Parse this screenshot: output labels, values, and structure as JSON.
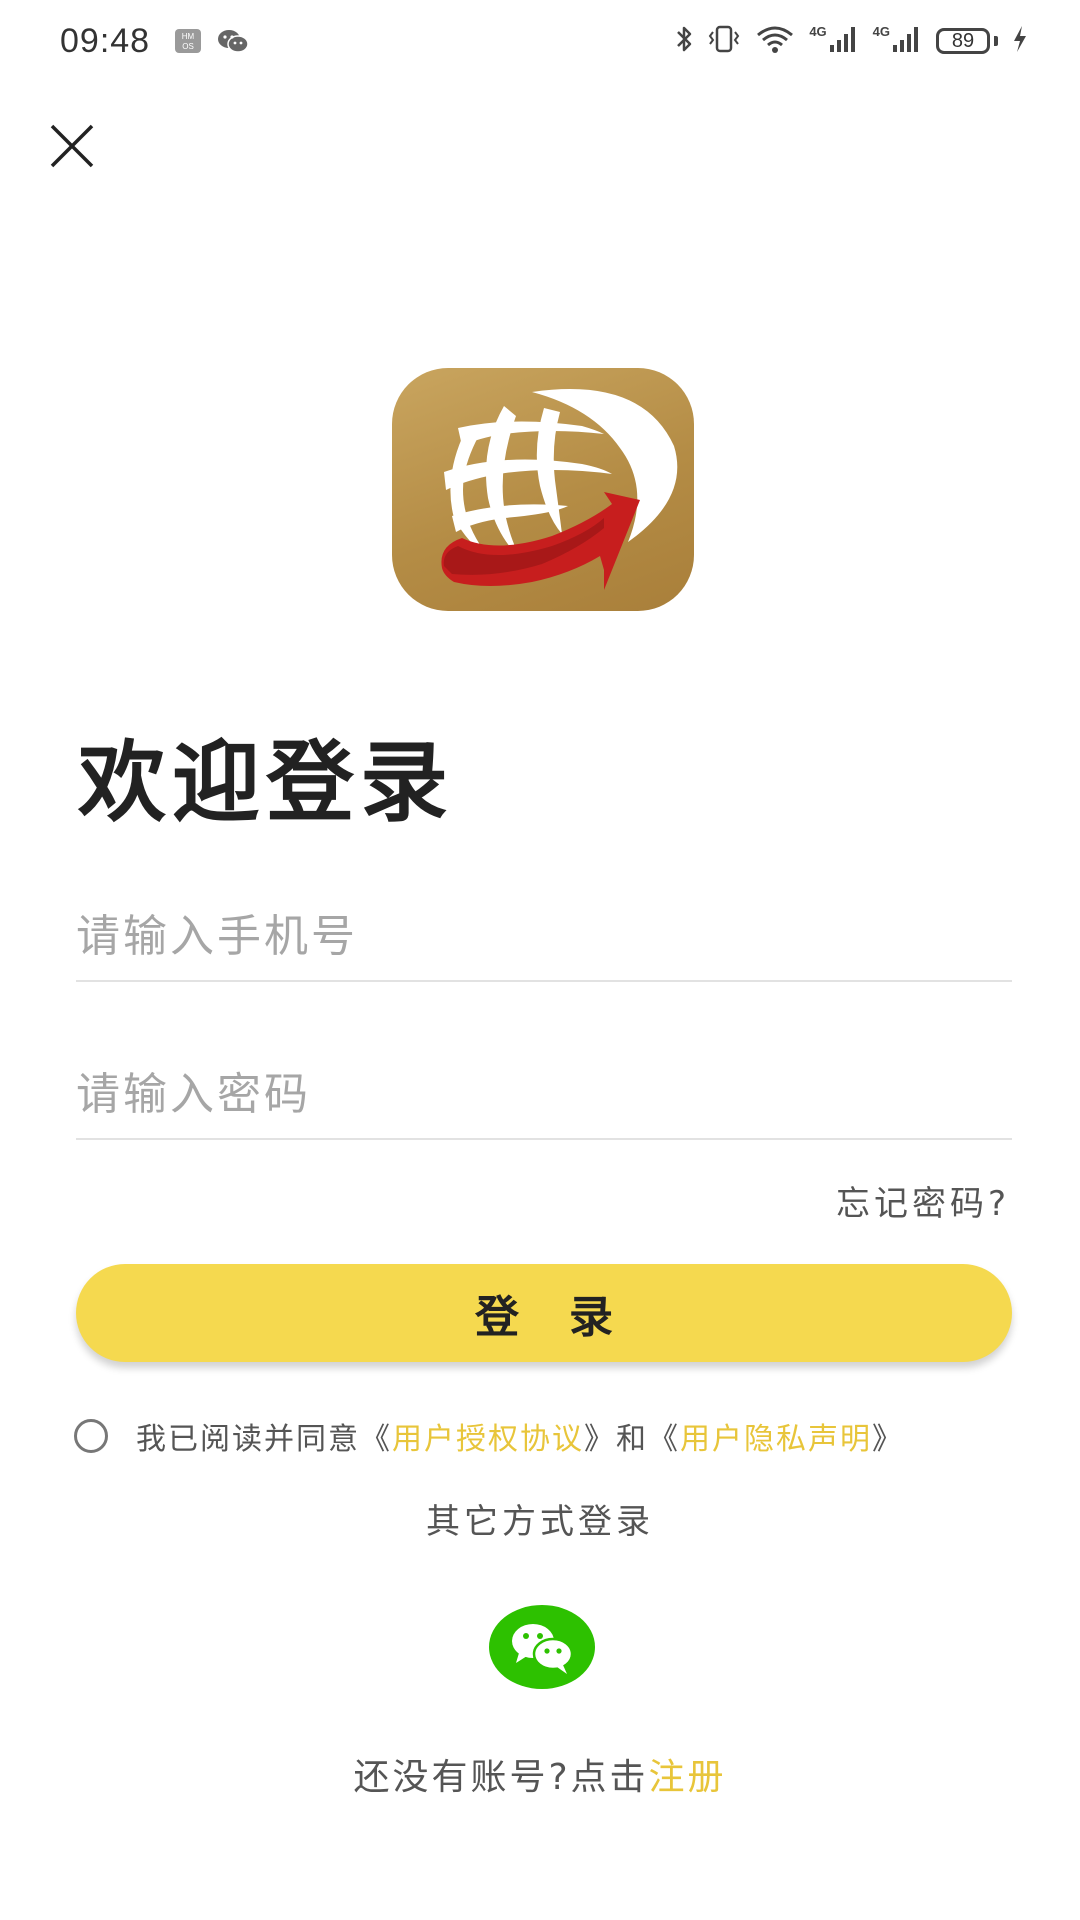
{
  "status_bar": {
    "time": "09:48",
    "battery": "89",
    "net_label_1": "4G",
    "net_label_2": "4G",
    "icons": [
      "hmos-icon",
      "wechat-notification-icon",
      "bluetooth-icon",
      "vibrate-icon",
      "wifi-icon",
      "signal-icon",
      "signal-icon",
      "battery-icon",
      "charging-icon"
    ]
  },
  "header": {
    "close_icon": "close-icon"
  },
  "logo": {
    "icon": "globe-arrow-logo",
    "colors": {
      "background": "#b98f48",
      "arrow": "#c21c1c"
    }
  },
  "form": {
    "title": "欢迎登录",
    "phone_placeholder": "请输入手机号",
    "phone_value": "",
    "password_placeholder": "请输入密码",
    "password_value": "",
    "forgot_label": "忘记密码?",
    "login_label": "登录"
  },
  "agreement": {
    "prefix": "我已阅读并同意《",
    "link1": "用户授权协议",
    "middle": "》和《",
    "link2": "用户隐私声明",
    "suffix": "》",
    "checked": false
  },
  "other_login": {
    "label": "其它方式登录",
    "wechat_icon": "wechat-icon"
  },
  "signup": {
    "prefix": "还没有账号?点击",
    "link": "注册"
  },
  "colors": {
    "accent": "#f5d94f",
    "link": "#e8c53a",
    "wechat": "#2dc100"
  }
}
